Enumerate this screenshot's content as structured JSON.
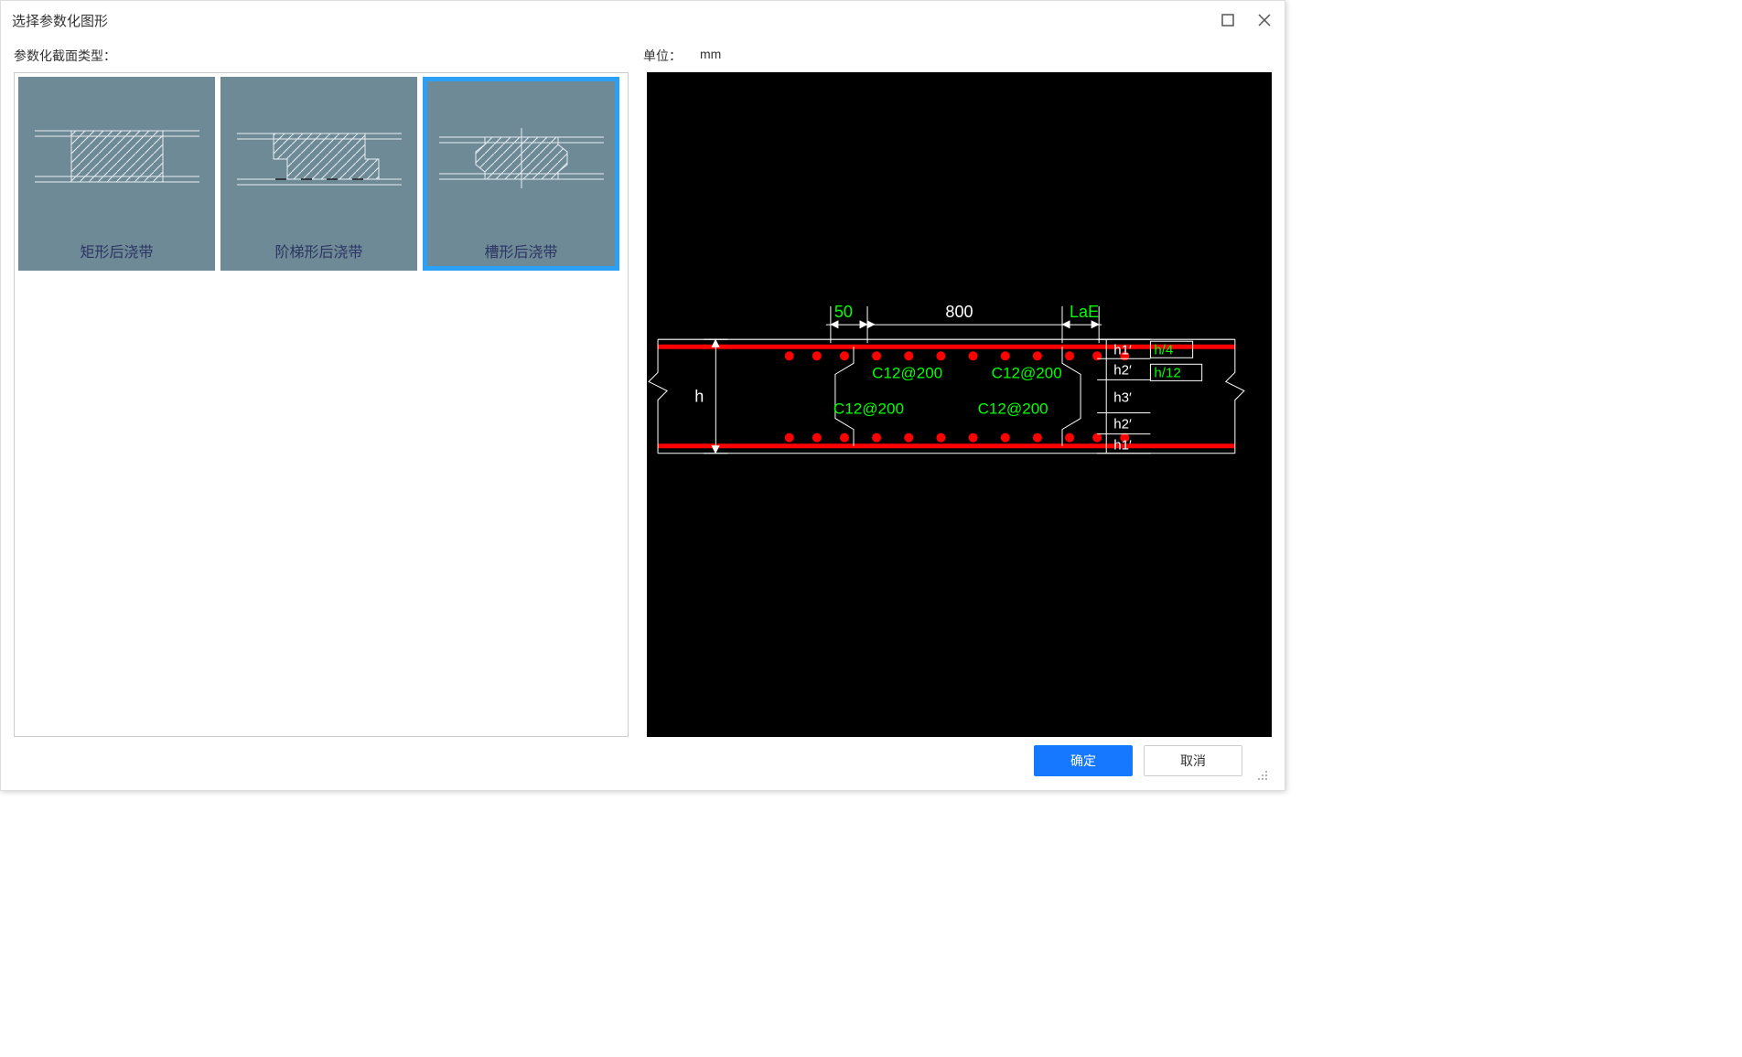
{
  "titlebar": {
    "title": "选择参数化图形"
  },
  "labels": {
    "section_type": "参数化截面类型：",
    "unit_label": "单位：",
    "unit_value": "mm"
  },
  "section_options": [
    {
      "id": "rect",
      "label": "矩形后浇带",
      "selected": false,
      "shape": "rect"
    },
    {
      "id": "step",
      "label": "阶梯形后浇带",
      "selected": false,
      "shape": "step"
    },
    {
      "id": "groove",
      "label": "槽形后浇带",
      "selected": true,
      "shape": "groove"
    }
  ],
  "preview": {
    "dims_top": {
      "left": "50",
      "mid": "800",
      "right": "LaE"
    },
    "side": {
      "total": "h",
      "rows": [
        "h1′",
        "h2′",
        "h3′",
        "h2′",
        "h1′"
      ],
      "right_param_top": "h/4",
      "right_param_mid": "h/12"
    },
    "rebar_specs": [
      "C12@200",
      "C12@200",
      "C12@200",
      "C12@200"
    ]
  },
  "buttons": {
    "ok": "确定",
    "cancel": "取消"
  }
}
